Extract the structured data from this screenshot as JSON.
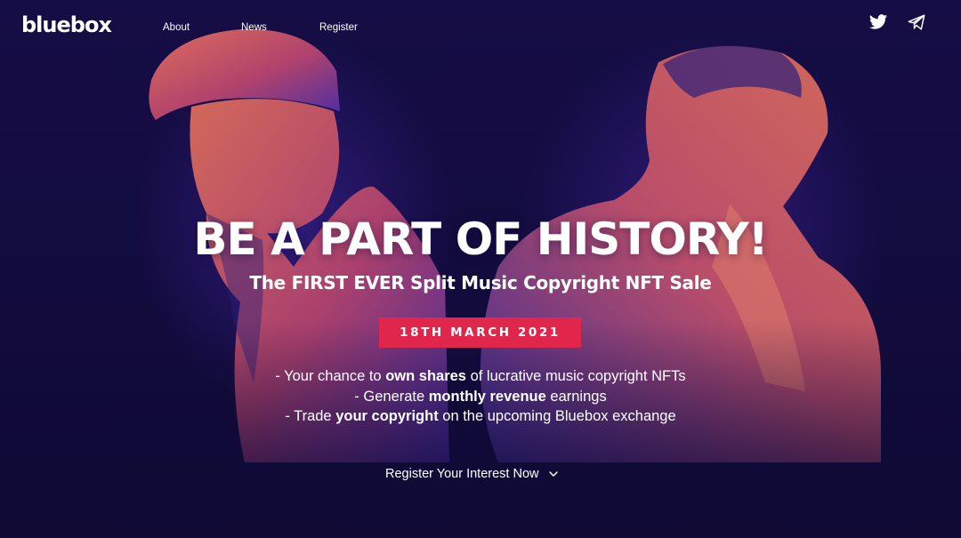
{
  "brand": {
    "logo_text": "bluebox"
  },
  "nav": {
    "items": [
      {
        "label": "About"
      },
      {
        "label": "News"
      },
      {
        "label": "Register"
      }
    ],
    "social_icons": [
      "twitter-icon",
      "telegram-icon"
    ]
  },
  "hero": {
    "headline": "BE A PART OF HISTORY!",
    "subheadline": "The FIRST EVER Split Music Copyright NFT Sale",
    "date_badge": "18TH MARCH 2021",
    "bullets": [
      {
        "pre": "- Your chance to ",
        "bold": "own shares",
        "post": " of lucrative music copyright NFTs"
      },
      {
        "pre": "- Generate ",
        "bold": "monthly revenue",
        "post": " earnings"
      },
      {
        "pre": "- Trade ",
        "bold": "your copyright",
        "post": " on the upcoming Bluebox exchange"
      }
    ],
    "cta_label": "Register Your Interest Now"
  },
  "colors": {
    "background": "#120c3e",
    "accent_red": "#e0264a",
    "duotone_warm": "#e66a5c",
    "duotone_cool": "#3a2aa6",
    "text": "#ffffff"
  }
}
